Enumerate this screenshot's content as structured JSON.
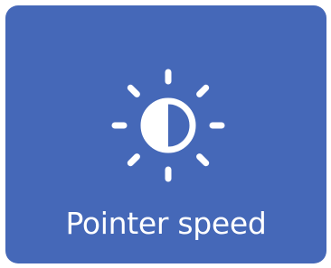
{
  "tile": {
    "label": "Pointer speed",
    "icon": "brightness-icon",
    "background_color": "#4568b8",
    "foreground_color": "#ffffff"
  }
}
